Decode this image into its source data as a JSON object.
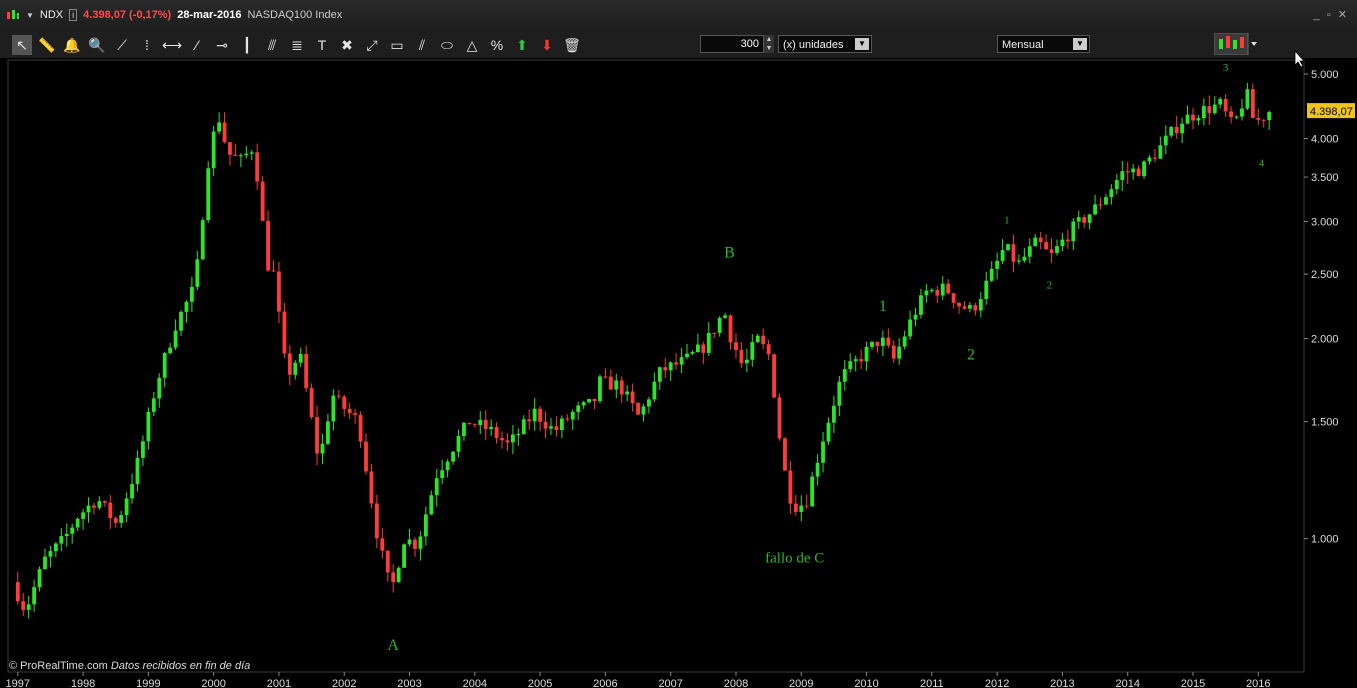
{
  "window": {
    "ticker": "NDX",
    "last_price": "4.398,07 (-0,17%)",
    "date": "28-mar-2016",
    "index_name": "NASDAQ100 Index",
    "controls": "_ ▫ ✕"
  },
  "toolbar": {
    "tools": [
      {
        "name": "pointer-icon",
        "glyph": "↖"
      },
      {
        "name": "ruler-icon",
        "glyph": "📏"
      },
      {
        "name": "alarm-bell-icon",
        "glyph": "🔔"
      },
      {
        "name": "zoom-icon",
        "glyph": "🔍"
      },
      {
        "name": "line-icon",
        "glyph": "⟋"
      },
      {
        "name": "vertical-line-icon",
        "glyph": "⁞"
      },
      {
        "name": "horizontal-segment-icon",
        "glyph": "⟷"
      },
      {
        "name": "trendline-icon",
        "glyph": "⁄"
      },
      {
        "name": "horizontal-line-icon",
        "glyph": "⊸"
      },
      {
        "name": "vertical-marker-icon",
        "glyph": "┃"
      },
      {
        "name": "fibonacci-fan-icon",
        "glyph": "⫻"
      },
      {
        "name": "fibonacci-retracement-icon",
        "glyph": "≣"
      },
      {
        "name": "text-icon",
        "glyph": "T"
      },
      {
        "name": "tools-icon",
        "glyph": "✖"
      },
      {
        "name": "arrow-icon",
        "glyph": "⤢"
      },
      {
        "name": "rectangle-icon",
        "glyph": "▭"
      },
      {
        "name": "channel-icon",
        "glyph": "⫽"
      },
      {
        "name": "ellipse-icon",
        "glyph": "⬭"
      },
      {
        "name": "triangle-icon",
        "glyph": "△"
      },
      {
        "name": "percent-icon",
        "glyph": "%"
      },
      {
        "name": "up-arrow-icon",
        "glyph": "⬆"
      },
      {
        "name": "down-arrow-icon",
        "glyph": "⬇"
      },
      {
        "name": "trash-icon",
        "glyph": "🗑"
      }
    ],
    "units_value": "300",
    "units_label": "(x) unidades",
    "period": "Mensual"
  },
  "footer": {
    "source": "© ProRealTime.com",
    "note": "Datos recibidos en fin de día"
  },
  "chart_data": {
    "type": "candlestick",
    "title": "",
    "scale": "log",
    "ylim": [
      630,
      5250
    ],
    "xlim": [
      1996.85,
      2016.7
    ],
    "y_ticks": [
      {
        "value": 1000,
        "label": "1.000"
      },
      {
        "value": 1500,
        "label": "1.500"
      },
      {
        "value": 2000,
        "label": "2.000"
      },
      {
        "value": 2500,
        "label": "2.500"
      },
      {
        "value": 3000,
        "label": "3.000"
      },
      {
        "value": 3500,
        "label": "3.500"
      },
      {
        "value": 4000,
        "label": "4.000"
      },
      {
        "value": 5000,
        "label": "5.000"
      }
    ],
    "x_ticks": [
      "1997",
      "1998",
      "1999",
      "2000",
      "2001",
      "2002",
      "2003",
      "2004",
      "2005",
      "2006",
      "2007",
      "2008",
      "2009",
      "2010",
      "2011",
      "2012",
      "2013",
      "2014",
      "2015",
      "2016"
    ],
    "last_price_label": "4.398,07",
    "last_price": 4398.07,
    "colors": {
      "up": "#29e629",
      "down": "#ff3b3b",
      "annotation": "#2db52d",
      "price_tag": "#f0c419"
    },
    "path": [
      [
        1997.0,
        860
      ],
      [
        1997.2,
        780
      ],
      [
        1997.5,
        930
      ],
      [
        1997.8,
        1000
      ],
      [
        1998.0,
        1080
      ],
      [
        1998.3,
        1150
      ],
      [
        1998.6,
        1050
      ],
      [
        1998.9,
        1280
      ],
      [
        1999.0,
        1400
      ],
      [
        1999.2,
        1700
      ],
      [
        1999.5,
        2100
      ],
      [
        1999.8,
        2400
      ],
      [
        2000.0,
        3700
      ],
      [
        2000.15,
        4350
      ],
      [
        2000.3,
        3800
      ],
      [
        2000.5,
        3700
      ],
      [
        2000.7,
        3900
      ],
      [
        2000.9,
        2600
      ],
      [
        2001.0,
        2500
      ],
      [
        2001.2,
        1750
      ],
      [
        2001.4,
        1900
      ],
      [
        2001.7,
        1300
      ],
      [
        2001.9,
        1650
      ],
      [
        2002.0,
        1600
      ],
      [
        2002.3,
        1500
      ],
      [
        2002.6,
        1000
      ],
      [
        2002.8,
        830
      ],
      [
        2003.0,
        1000
      ],
      [
        2003.2,
        980
      ],
      [
        2003.5,
        1250
      ],
      [
        2003.8,
        1400
      ],
      [
        2004.0,
        1500
      ],
      [
        2004.3,
        1460
      ],
      [
        2004.6,
        1380
      ],
      [
        2005.0,
        1550
      ],
      [
        2005.3,
        1450
      ],
      [
        2005.6,
        1550
      ],
      [
        2005.9,
        1600
      ],
      [
        2006.0,
        1720
      ],
      [
        2006.3,
        1700
      ],
      [
        2006.6,
        1520
      ],
      [
        2006.9,
        1770
      ],
      [
        2007.0,
        1800
      ],
      [
        2007.3,
        1850
      ],
      [
        2007.6,
        1950
      ],
      [
        2007.9,
        2200
      ],
      [
        2008.0,
        2020
      ],
      [
        2008.2,
        1800
      ],
      [
        2008.4,
        2000
      ],
      [
        2008.6,
        1880
      ],
      [
        2008.8,
        1300
      ],
      [
        2008.95,
        1120
      ],
      [
        2009.15,
        1130
      ],
      [
        2009.4,
        1400
      ],
      [
        2009.7,
        1750
      ],
      [
        2010.0,
        1880
      ],
      [
        2010.3,
        2000
      ],
      [
        2010.5,
        1860
      ],
      [
        2010.8,
        2170
      ],
      [
        2011.0,
        2350
      ],
      [
        2011.3,
        2380
      ],
      [
        2011.5,
        2250
      ],
      [
        2011.7,
        2200
      ],
      [
        2012.0,
        2500
      ],
      [
        2012.2,
        2750
      ],
      [
        2012.4,
        2580
      ],
      [
        2012.7,
        2800
      ],
      [
        2012.9,
        2650
      ],
      [
        2013.2,
        2900
      ],
      [
        2013.6,
        3150
      ],
      [
        2014.0,
        3550
      ],
      [
        2014.3,
        3600
      ],
      [
        2014.6,
        3900
      ],
      [
        2014.9,
        4250
      ],
      [
        2015.2,
        4400
      ],
      [
        2015.5,
        4500
      ],
      [
        2015.7,
        4150
      ],
      [
        2015.9,
        4700
      ],
      [
        2016.0,
        4300
      ],
      [
        2016.1,
        4250
      ],
      [
        2016.23,
        4398
      ]
    ],
    "annotations": [
      {
        "label": "A",
        "x": 2002.75,
        "y": 680,
        "size": 16
      },
      {
        "label": "B",
        "x": 2007.9,
        "y": 2650,
        "size": 16
      },
      {
        "label": "fallo de C",
        "x": 2008.9,
        "y": 920,
        "size": 15
      },
      {
        "label": "1",
        "x": 2010.25,
        "y": 2200,
        "size": 16
      },
      {
        "label": "2",
        "x": 2011.6,
        "y": 1860,
        "size": 16
      },
      {
        "label": "1",
        "x": 2012.15,
        "y": 2980,
        "size": 11
      },
      {
        "label": "2",
        "x": 2012.8,
        "y": 2380,
        "size": 11
      },
      {
        "label": "3",
        "x": 2015.5,
        "y": 5050,
        "size": 11
      },
      {
        "label": "4",
        "x": 2016.05,
        "y": 3630,
        "size": 11
      }
    ]
  }
}
